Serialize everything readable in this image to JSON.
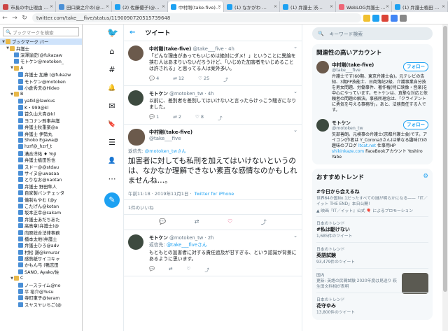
{
  "browser": {
    "tabs": [
      {
        "title": "市長の中止理由 …",
        "color": "#c44"
      },
      {
        "title": "田口康之介の(@… ",
        "color": "#4a8fd6"
      },
      {
        "title": "(2) 佐藤優子(@…",
        "color": "#1da1f2"
      },
      {
        "title": "中村剛(take-five)…",
        "color": "#1da1f2",
        "active": true
      },
      {
        "title": "(1) なかがわ …",
        "color": "#1da1f2"
      },
      {
        "title": "(1) 弁護士 渋…",
        "color": "#1da1f2"
      },
      {
        "title": "WebLOG弁護士 …",
        "color": "#e67"
      },
      {
        "title": "(1) 弁護士植田 …",
        "color": "#1da1f2"
      }
    ],
    "url": "twitter.com/take___five/status/1190090720515739648"
  },
  "bookmarks": {
    "search_placeholder": "ブックマークを検索",
    "items": [
      {
        "label": "ブックマーク バー",
        "type": "folder",
        "depth": 0,
        "open": true,
        "selected": true
      },
      {
        "label": "弁護士",
        "type": "folder",
        "depth": 1,
        "open": true
      },
      {
        "label": "深澤諭史(@fukazaw",
        "type": "page",
        "depth": 2
      },
      {
        "label": "モトケン@motoken_",
        "type": "page",
        "depth": 2
      },
      {
        "label": "A",
        "type": "folder",
        "depth": 2,
        "open": true
      },
      {
        "label": "弁護士 加藤 (@fukazw",
        "type": "page",
        "depth": 3
      },
      {
        "label": "モトケン@motoken",
        "type": "page",
        "depth": 3
      },
      {
        "label": "小倉秀夫@Hideo",
        "type": "page",
        "depth": 3
      },
      {
        "label": "B",
        "type": "folder",
        "depth": 2,
        "open": true
      },
      {
        "label": "yatkl@lawkus",
        "type": "page",
        "depth": 3
      },
      {
        "label": "K・999@kl",
        "type": "page",
        "depth": 3
      },
      {
        "label": "首久山大貴@kl",
        "type": "page",
        "depth": 3
      },
      {
        "label": "ヨコナン刑事弁護",
        "type": "page",
        "depth": 3
      },
      {
        "label": "弁護士秋重楽@a",
        "type": "page",
        "depth": 3
      },
      {
        "label": "弁護士 伊勢丸",
        "type": "page",
        "depth": 3
      },
      {
        "label": "Shoko Egawa@",
        "type": "page",
        "depth": 3
      },
      {
        "label": "hzrf@_hzrf_t",
        "type": "page",
        "depth": 3
      },
      {
        "label": "溝合洋祐 ♦ Yoji",
        "type": "page",
        "depth": 3
      },
      {
        "label": "弁護士植田哲也",
        "type": "page",
        "depth": 3
      },
      {
        "label": "スドー@@stdau",
        "type": "page",
        "depth": 3
      },
      {
        "label": "サイヌ@uwasaa",
        "type": "page",
        "depth": 3
      },
      {
        "label": "とりなお@naotan",
        "type": "page",
        "depth": 3
      },
      {
        "label": "弁護士 野田隼人",
        "type": "page",
        "depth": 3
      },
      {
        "label": "自家製バンチェッタ",
        "type": "page",
        "depth": 3
      },
      {
        "label": "儀制もやむ (@y",
        "type": "page",
        "depth": 3
      },
      {
        "label": "こたげん@kotan",
        "type": "page",
        "depth": 3
      },
      {
        "label": "坂本正幸@sakam",
        "type": "page",
        "depth": 3
      },
      {
        "label": "弁護士あだちあた",
        "type": "page",
        "depth": 3
      },
      {
        "label": "高島章(弁護士)@",
        "type": "page",
        "depth": 3
      },
      {
        "label": "向原総合法律事務",
        "type": "page",
        "depth": 3
      },
      {
        "label": "橋本太地(弁護士",
        "type": "page",
        "depth": 3
      },
      {
        "label": "弁護士ひろ@adv",
        "type": "page",
        "depth": 3
      },
      {
        "label": "村松 謙@kmurar",
        "type": "page",
        "depth": 3
      },
      {
        "label": "感熱紙サイコキャ",
        "type": "page",
        "depth": 3
      },
      {
        "label": "かもん弓 (鴨志田",
        "type": "page",
        "depth": 3
      },
      {
        "label": "SANO, Ayako/佐",
        "type": "page",
        "depth": 3
      },
      {
        "label": "C",
        "type": "folder",
        "depth": 2,
        "open": true
      },
      {
        "label": "ノースライム@no",
        "type": "page",
        "depth": 3
      },
      {
        "label": "平 裕介@Yusu",
        "type": "page",
        "depth": 3
      },
      {
        "label": "寺町東子@teram",
        "type": "page",
        "depth": 3
      },
      {
        "label": "スヤスヤいちご(@",
        "type": "page",
        "depth": 3
      }
    ]
  },
  "twitter_nav": {
    "home": "⌂",
    "explore": "#",
    "notifications": "🔔",
    "messages": "✉",
    "bookmarks": "🔖",
    "lists": "☰",
    "profile": "👤",
    "more": "⋯",
    "tweet": "✎"
  },
  "main": {
    "header": {
      "title": "ツイート",
      "back": "←"
    },
    "tweets": [
      {
        "name": "中村剛(take-five)",
        "handle": "@take___five · 4h",
        "text": "「どんな理由があってもいじめは絶対にダメ！」ということに異論を挟む人はあまりいないだろうけど、「いじめた加害者をいじめることは許される」と思ってる人は案外多い。",
        "replies": "4",
        "retweets": "12",
        "likes": "25"
      },
      {
        "name": "モトケン",
        "handle": "@motoken_tw · 4h",
        "text": "以前に、差別者を差別してはいけないと言ったらけっこう騒ぎになりました。",
        "replies": "1",
        "retweets": "2",
        "likes": "8"
      }
    ],
    "focused": {
      "name": "中村剛(take-five)",
      "handle": "@take___five",
      "reply_prefix": "返信先:",
      "reply_to": "@motoken_twさん",
      "text": "加害者に対しても私刑を加えてはいけないというのは、なかなか理解できない素直な感情なのかもしれませんね…。",
      "time": "午前11:18 · 2019年11月1日 ·",
      "client": "Twitter for iPhone",
      "likes_label": "1件のいいね"
    },
    "reply": {
      "name": "モトケン",
      "handle": "@motoken_tw · 2h",
      "reply_prefix": "返信先:",
      "reply_to": "@take___fiveさん",
      "text": "もともとの加害者に対する責任追及が甘すぎる、という認識が背景にあるように思います。",
      "replies": "",
      "retweets": "",
      "likes": ""
    }
  },
  "right": {
    "search_placeholder": "キーワード検索",
    "related_title": "関連性の高いアカウント",
    "accounts": [
      {
        "name": "中村剛(take-five)",
        "handle": "@take___five",
        "bio": "弁護士です(60期、東京弁護士会)。元テレビの告知、3期FP技能士、日商簿記2級、介護事業自分技を男女問題、労働事件、著作権(特に映像・音楽)を中心にやっています。モトケンは、真摯な対応と依頼者の問題の解決。事務所理念は、「クライアントに勇気を与える事務所」。あと、法務責任する人です。",
        "follow": "フォロー"
      },
      {
        "name": "モトケン",
        "handle": "@motoken_tw",
        "bio": "矢部善朗。元検事の弁護士(京都弁護士会)です。アイコン(作者は Y_Corona3さん)は華なる趣味(?)の趣味のブログ",
        "link1": "ltcat.net",
        "bio2": "仕事用HP",
        "link2": "shikinkaze.com",
        "bio3": "FaceBookアカウント Yoshiro Yabe",
        "follow": "フォロー"
      }
    ],
    "trends_title": "おすすめトレンド",
    "trends": [
      {
        "category": "",
        "title": "#今日から会えるね",
        "desc": "世界64か国No.1だったすべての謎が明らかになる——「IT／イット THE END」本日公開!",
        "promo": "▲ 映画『IT／イット』公式 🎈 によるプロモーション"
      },
      {
        "category": "日本のトレンド",
        "title": "#私は駆けない",
        "desc": "1,685件のツイート",
        "promo": ""
      },
      {
        "category": "日本のトレンド",
        "title": "英語試験",
        "desc": "93,479件のツイート",
        "promo": ""
      },
      {
        "category": "国内",
        "title": "",
        "desc": "更新: 英語の民間試験 2020年度は見送り 萩生田文科相が表明",
        "promo": "",
        "thumb": true
      },
      {
        "category": "日本のトレンド",
        "title": "花守ゆみ",
        "desc": "13,800件のツイート",
        "promo": ""
      }
    ]
  }
}
